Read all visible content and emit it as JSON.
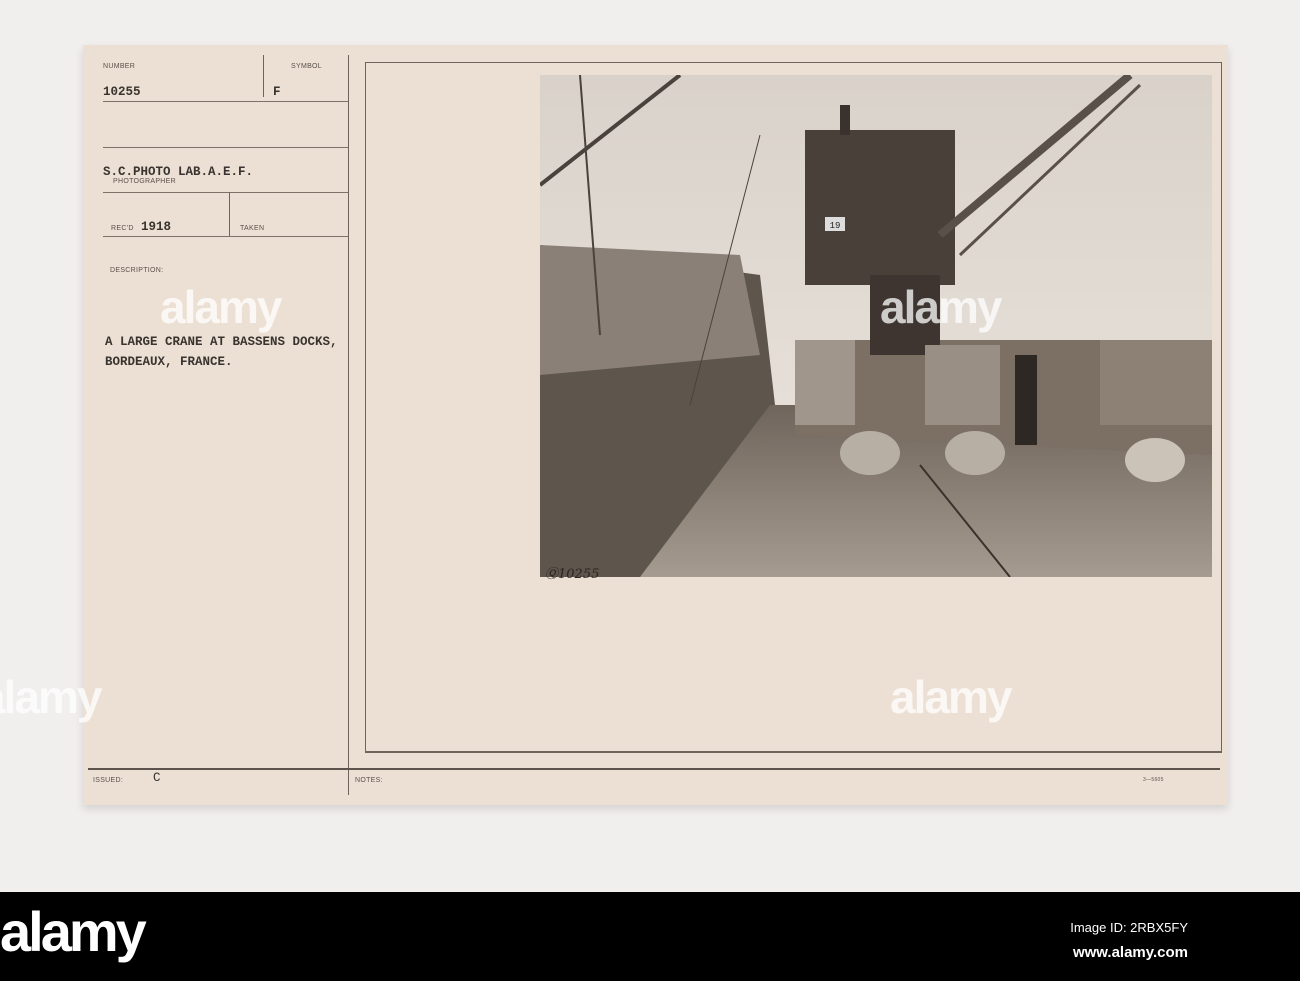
{
  "card": {
    "number_label": "NUMBER",
    "number": "10255",
    "symbol_label": "SYMBOL",
    "symbol": "F",
    "photographer": "S.C.PHOTO LAB.A.E.F.",
    "photographer_label": "PHOTOGRAPHER",
    "recd_label": "REC'D",
    "recd": "1918",
    "taken_label": "TAKEN",
    "description_label": "DESCRIPTION:",
    "description_line1": "A LARGE CRANE AT BASSENS DOCKS,",
    "description_line2": "BORDEAUX, FRANCE.",
    "issued_label": "ISSUED:",
    "issued": "C",
    "notes_label": "NOTES:",
    "form_number": "3—5605",
    "photo_inscription": "Ⓠ10255",
    "crane_number": "19"
  },
  "watermark": "alamy",
  "footer": {
    "logo": "alamy",
    "image_id": "Image ID: 2RBX5FY",
    "url": "www.alamy.com"
  },
  "colors": {
    "card": "#ebe0d3",
    "ink": "#3a3430",
    "footer": "#000000"
  }
}
